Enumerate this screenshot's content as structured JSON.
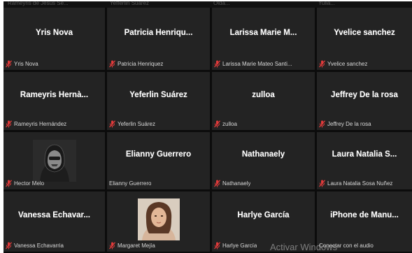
{
  "top_row": [
    "Rameyris de Jesus Se...",
    "Yefferlin Suarez",
    "Olda...",
    "Yulia..."
  ],
  "tiles": [
    {
      "name": "Yris Nova",
      "footer": "Yris Nova",
      "muted": true
    },
    {
      "name": "Patricia  Henriqu...",
      "footer": "Patricia Henriquez",
      "muted": true
    },
    {
      "name": "Larissa  Marie  M...",
      "footer": "Larissa Marie Mateo Santi...",
      "muted": true
    },
    {
      "name": "Yvelice sanchez",
      "footer": "Yvelice sanchez",
      "muted": true
    },
    {
      "name": "Rameyris  Hernà...",
      "footer": "Rameyris Hernández",
      "muted": true
    },
    {
      "name": "Yeferlin Suárez",
      "footer": "Yeferlin Suárez",
      "muted": true
    },
    {
      "name": "zulloa",
      "footer": "zulloa",
      "muted": true
    },
    {
      "name": "Jeffrey De la rosa",
      "footer": "Jeffrey De la rosa",
      "muted": true
    },
    {
      "name": "",
      "footer": "Hector Melo",
      "muted": true,
      "media": "avatar"
    },
    {
      "name": "Elianny Guerrero",
      "footer": "Elianny Guerrero",
      "muted": false
    },
    {
      "name": "Nathanaely",
      "footer": "Nathanaely",
      "muted": true
    },
    {
      "name": "Laura  Natalia S...",
      "footer": "Laura  Natalia Sosa Nuñez",
      "muted": true
    },
    {
      "name": "Vanessa  Echavar...",
      "footer": "Vanessa Echavarria",
      "muted": true
    },
    {
      "name": "",
      "footer": "Margaret Mejía",
      "muted": true,
      "media": "photo"
    },
    {
      "name": "Harlye García",
      "footer": "Harlye García",
      "muted": true
    },
    {
      "name": "iPhone  de  Manu...",
      "footer": "Conectar con el audio",
      "muted": false
    }
  ],
  "watermark": "Activar Windows",
  "colors": {
    "mic_muted": "#e03a3a",
    "tile_bg": "#232323",
    "gap_bg": "#0c0c0c"
  }
}
